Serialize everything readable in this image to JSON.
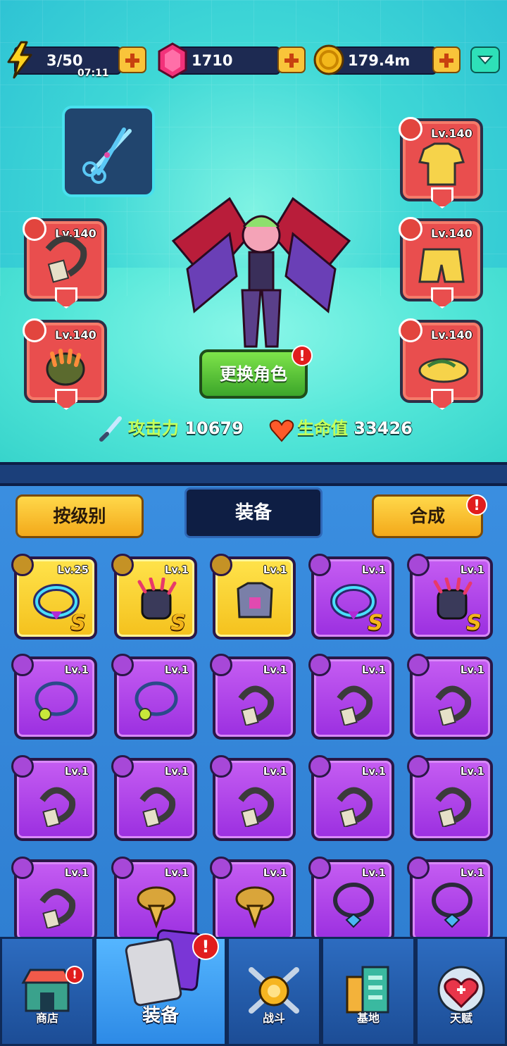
{
  "resources": {
    "energy": "3/50",
    "energy_timer": "07:11",
    "gems": "1710",
    "coins": "179.4m"
  },
  "equipment_slots": {
    "necklace_level": "Lv.140",
    "glove_level": "Lv.140",
    "shirt_level": "Lv.140",
    "pants_level": "Lv.140",
    "shoes_level": "Lv.140"
  },
  "character": {
    "change_button": "更换角色",
    "alert": "!",
    "attack_label": "攻击力",
    "attack_value": "10679",
    "hp_label": "生命值",
    "hp_value": "33426"
  },
  "inventory_tabs": {
    "sort_label": "按级别",
    "equip_label": "装备",
    "merge_label": "合成",
    "merge_alert": "!"
  },
  "inventory": [
    {
      "level": "Lv.25",
      "rarity": "gold",
      "slot": "necklace",
      "grade": "S",
      "art": "neon-collar"
    },
    {
      "level": "Lv.1",
      "rarity": "gold",
      "slot": "glove",
      "grade": "S",
      "art": "claw-glove"
    },
    {
      "level": "Lv.1",
      "rarity": "gold",
      "slot": "shirt",
      "grade": "",
      "art": "armor-vest"
    },
    {
      "level": "Lv.1",
      "rarity": "purple",
      "slot": "necklace",
      "grade": "S",
      "art": "neon-collar"
    },
    {
      "level": "Lv.1",
      "rarity": "purple",
      "slot": "glove",
      "grade": "S",
      "art": "claw-glove"
    },
    {
      "level": "Lv.1",
      "rarity": "purple",
      "slot": "necklace",
      "grade": "",
      "art": "ball-necklace"
    },
    {
      "level": "Lv.1",
      "rarity": "purple",
      "slot": "necklace",
      "grade": "",
      "art": "ball-necklace"
    },
    {
      "level": "Lv.1",
      "rarity": "purple",
      "slot": "necklace",
      "grade": "",
      "art": "tag-necklace"
    },
    {
      "level": "Lv.1",
      "rarity": "purple",
      "slot": "necklace",
      "grade": "",
      "art": "tag-necklace"
    },
    {
      "level": "Lv.1",
      "rarity": "purple",
      "slot": "necklace",
      "grade": "",
      "art": "tag-necklace"
    },
    {
      "level": "Lv.1",
      "rarity": "purple",
      "slot": "necklace",
      "grade": "",
      "art": "tag-necklace"
    },
    {
      "level": "Lv.1",
      "rarity": "purple",
      "slot": "necklace",
      "grade": "",
      "art": "tag-necklace"
    },
    {
      "level": "Lv.1",
      "rarity": "purple",
      "slot": "necklace",
      "grade": "",
      "art": "tag-necklace"
    },
    {
      "level": "Lv.1",
      "rarity": "purple",
      "slot": "necklace",
      "grade": "",
      "art": "tag-necklace"
    },
    {
      "level": "Lv.1",
      "rarity": "purple",
      "slot": "necklace",
      "grade": "",
      "art": "tag-necklace"
    },
    {
      "level": "Lv.1",
      "rarity": "purple",
      "slot": "necklace",
      "grade": "",
      "art": "tag-necklace"
    },
    {
      "level": "Lv.1",
      "rarity": "purple",
      "slot": "necklace",
      "grade": "",
      "art": "scarf"
    },
    {
      "level": "Lv.1",
      "rarity": "purple",
      "slot": "necklace",
      "grade": "",
      "art": "scarf"
    },
    {
      "level": "Lv.1",
      "rarity": "purple",
      "slot": "necklace",
      "grade": "",
      "art": "gem-choker"
    },
    {
      "level": "Lv.1",
      "rarity": "purple",
      "slot": "necklace",
      "grade": "",
      "art": "gem-choker"
    }
  ],
  "nav": {
    "shop": "商店",
    "equipment": "装备",
    "battle": "战斗",
    "base": "基地",
    "talent": "天赋",
    "alert": "!"
  },
  "colors": {
    "gold_rarity": "#f4c11d",
    "purple_rarity": "#9b2fe0",
    "slot_red": "#e94e4e",
    "hero_bg": "#3fd8d6"
  }
}
